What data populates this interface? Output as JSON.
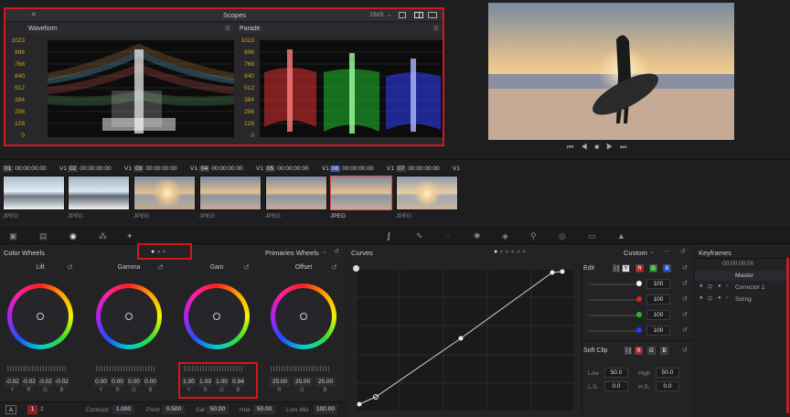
{
  "scopes": {
    "title": "Scopes",
    "aspect": "16x9",
    "waveform_label": "Waveform",
    "parade_label": "Parade",
    "y_ticks": [
      "1023",
      "896",
      "768",
      "640",
      "512",
      "384",
      "256",
      "128",
      "0"
    ]
  },
  "clips": [
    {
      "num": "01",
      "tc": "00:00:00:00",
      "track": "V1",
      "type": "JPEG"
    },
    {
      "num": "02",
      "tc": "00:00:00:00",
      "track": "V1",
      "type": "JPEG"
    },
    {
      "num": "03",
      "tc": "00:00:00:00",
      "track": "V1",
      "type": "JPEG"
    },
    {
      "num": "04",
      "tc": "00:00:00:00",
      "track": "V1",
      "type": "JPEG"
    },
    {
      "num": "05",
      "tc": "00:00:00:00",
      "track": "V1",
      "type": "JPEG"
    },
    {
      "num": "06",
      "tc": "00:00:00:00",
      "track": "V1",
      "type": "JPEG"
    },
    {
      "num": "07",
      "tc": "00:00:00:00",
      "track": "V1",
      "type": "JPEG"
    }
  ],
  "color_wheels": {
    "title": "Color Wheels",
    "mode": "Primaries Wheels",
    "wheels": [
      {
        "name": "Lift",
        "labels": [
          "Y",
          "R",
          "G",
          "B"
        ],
        "values": [
          "-0.02",
          "-0.02",
          "-0.02",
          "-0.02"
        ]
      },
      {
        "name": "Gamma",
        "labels": [
          "Y",
          "R",
          "G",
          "B"
        ],
        "values": [
          "0.00",
          "0.00",
          "0.00",
          "0.00"
        ]
      },
      {
        "name": "Gain",
        "labels": [
          "Y",
          "R",
          "G",
          "B"
        ],
        "values": [
          "1.00",
          "1.03",
          "1.00",
          "0.94"
        ]
      },
      {
        "name": "Offset",
        "labels": [
          "R",
          "G",
          "B"
        ],
        "values": [
          "25.00",
          "25.00",
          "25.00"
        ]
      }
    ],
    "footer": {
      "mode_a": "A",
      "page1": "1",
      "page2": "2",
      "contrast_label": "Contrast",
      "contrast": "1.000",
      "pivot_label": "Pivot",
      "pivot": "0.500",
      "sat_label": "Sat",
      "sat": "50.00",
      "hue_label": "Hue",
      "hue": "50.00",
      "lummix_label": "Lum Mix",
      "lummix": "100.00"
    }
  },
  "curves": {
    "title": "Curves",
    "mode": "Custom",
    "edit_label": "Edit",
    "channels": [
      {
        "color": "#ffffff",
        "value": "100"
      },
      {
        "color": "#e02020",
        "value": "100"
      },
      {
        "color": "#20c020",
        "value": "100"
      },
      {
        "color": "#2040ff",
        "value": "100"
      }
    ],
    "edit_buttons": [
      "Y",
      "R",
      "G",
      "B"
    ],
    "soft_clip": {
      "title": "Soft Clip",
      "buttons": [
        "R",
        "G",
        "B"
      ],
      "low_label": "Low",
      "low": "50.0",
      "high_label": "High",
      "high": "50.0",
      "ls_label": "L.S.",
      "ls": "0.0",
      "hs_label": "H.S.",
      "hs": "0.0"
    }
  },
  "keyframes": {
    "title": "Keyframes",
    "timecode": "00:00:00:00",
    "rows": [
      "Master",
      "Corrector 1",
      "Sizing"
    ]
  },
  "colors": {
    "highlight": "#d4171c",
    "accent": "#d5a21d"
  }
}
